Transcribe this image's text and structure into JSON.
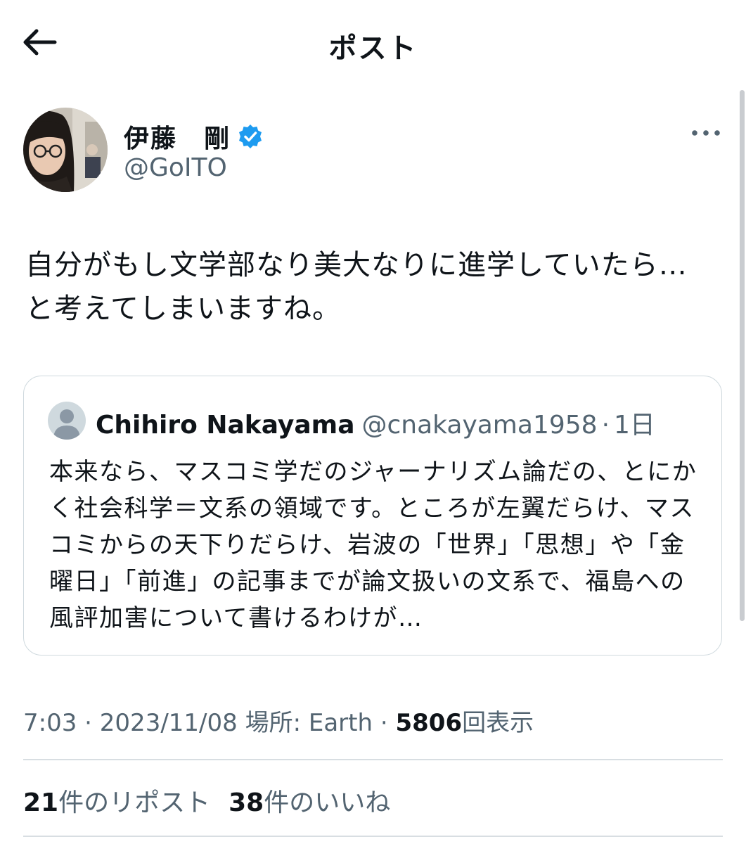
{
  "header": {
    "title": "ポスト",
    "back_icon": "arrow-left-icon"
  },
  "author": {
    "display_name": "伊藤　剛",
    "handle": "@GoITO",
    "verified": true,
    "verified_color": "#1d9bf0"
  },
  "post": {
    "text": "自分がもし文学部なり美大なりに進学していたら…\nと考えてしまいますね。"
  },
  "quoted": {
    "display_name": "Chihiro Nakayama",
    "handle": "@cnakayama1958",
    "separator": "·",
    "time": "1日",
    "text": "本来なら、マスコミ学だのジャーナリズム論だの、とにかく社会科学＝文系の領域です。ところが左翼だらけ、マスコミからの天下りだらけ、岩波の「世界」「思想」や「金曜日」「前進」の記事までが論文扱いの文系で、福島への風評加害について書けるわけが…"
  },
  "meta": {
    "time": "7:03",
    "sep1": "·",
    "date": "2023/11/08",
    "location": "場所: Earth",
    "sep2": "·",
    "views_count": "5806",
    "views_label": "回表示"
  },
  "stats": {
    "reposts_count": "21",
    "reposts_label": "件のリポスト",
    "likes_count": "38",
    "likes_label": "件のいいね"
  },
  "colors": {
    "text": "#0f1419",
    "secondary": "#536471",
    "border": "#cfd9de",
    "accent": "#1d9bf0"
  }
}
